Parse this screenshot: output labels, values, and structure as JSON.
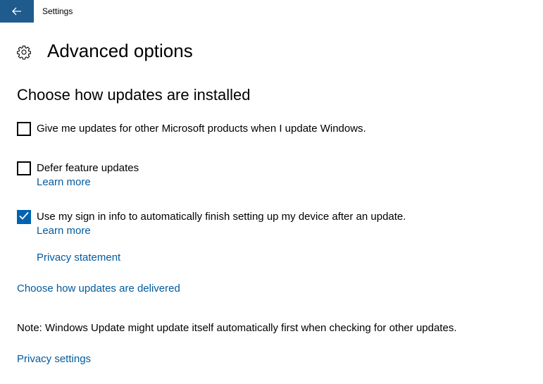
{
  "window": {
    "app_title": "Settings"
  },
  "header": {
    "icon": "gear-icon",
    "title": "Advanced options"
  },
  "section": {
    "title": "Choose how updates are installed"
  },
  "options": [
    {
      "label": "Give me updates for other Microsoft products when I update Windows.",
      "checked": false
    },
    {
      "label": "Defer feature updates",
      "checked": false,
      "link": "Learn more"
    },
    {
      "label": "Use my sign in info to automatically finish setting up my device after an update.",
      "checked": true,
      "link": "Learn more"
    }
  ],
  "links": {
    "privacy_statement": "Privacy statement",
    "delivery": "Choose how updates are delivered",
    "privacy_settings": "Privacy settings"
  },
  "note": "Note: Windows Update might update itself automatically first when checking for other updates.",
  "colors": {
    "accent": "#0063b1",
    "back_button": "#1f5b8c",
    "link": "#005a9e"
  }
}
